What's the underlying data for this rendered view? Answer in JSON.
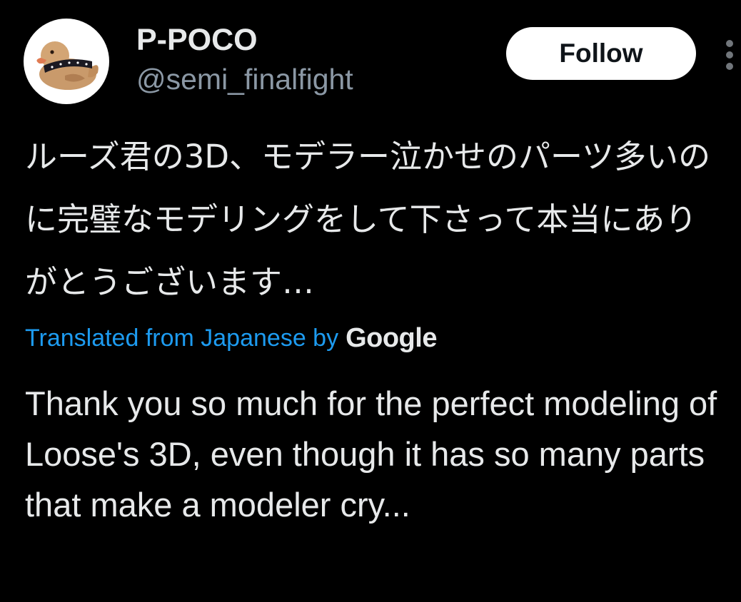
{
  "author": {
    "display_name": "P-POCO",
    "handle": "@semi_finalfight",
    "avatar": "duck-avatar"
  },
  "follow_button": {
    "label": "Follow"
  },
  "more_menu": {
    "icon": "more-vertical-icon"
  },
  "post": {
    "original_text": "ルーズ君の3D、モデラー泣かせのパーツ多いのに完璧なモデリングをして下さって本当にありがとうございます…",
    "translation_credit": "Translated from Japanese by",
    "translation_provider": "Google",
    "translated_text": "Thank you so much for the perfect modeling of Loose's 3D, even though it has so many parts that make a modeler cry..."
  },
  "colors": {
    "background": "#000000",
    "primary_text": "#e7e9ea",
    "secondary_text": "#8b98a5",
    "link": "#1d9bf0",
    "follow_bg": "#ffffff",
    "follow_text": "#0f1419"
  }
}
